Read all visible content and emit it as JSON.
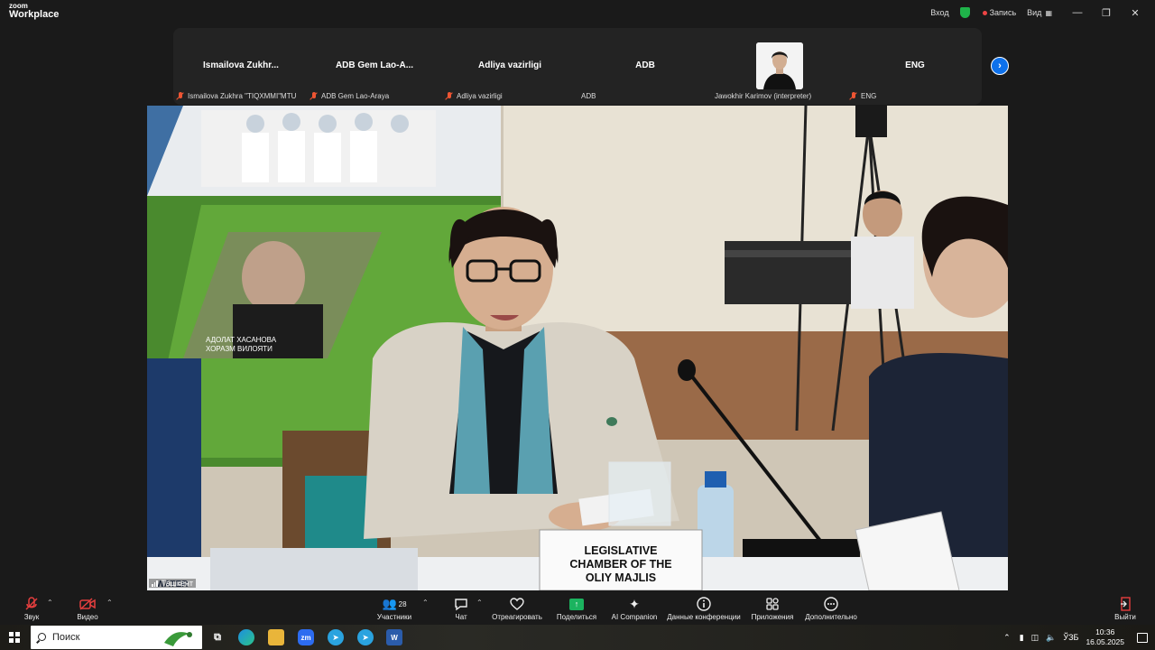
{
  "app": {
    "logo_top": "zoom",
    "logo_bottom": "Workplace"
  },
  "titlebar": {
    "signin": "Вход",
    "record": "Запись",
    "view": "Вид",
    "minimize": "—",
    "restore": "❐",
    "close": "✕"
  },
  "gallery": {
    "tiles": [
      {
        "name": "Ismailova  Zukhr...",
        "label": "Ismailova Zukhra \"TIQXMMI\"MTU",
        "muted": true
      },
      {
        "name": "ADB Gem Lao-A...",
        "label": "ADB Gem Lao-Araya",
        "muted": true
      },
      {
        "name": "Adliya vazirligi",
        "label": "Adliya vazirligi",
        "muted": true
      },
      {
        "name": "ADB",
        "label": "ADB",
        "muted": false
      },
      {
        "name": "",
        "label": "Jawokhir Karimov (interpreter)",
        "muted": false
      },
      {
        "name": "ENG",
        "label": "ENG",
        "muted": true
      }
    ],
    "next": "›"
  },
  "video": {
    "location_label": "Ташкент",
    "poster_caption_line1": "АДОЛАТ ХАСАНОВА",
    "poster_caption_line2": "ХОРАЗМ ВИЛОЯТИ",
    "nameplate": [
      "LEGISLATIVE",
      "CHAMBER OF THE",
      "OLIY MAJLIS"
    ],
    "corner_text": "WATER"
  },
  "toolbar": {
    "audio": "Звук",
    "video": "Видео",
    "participants": "Участники",
    "participants_count": "28",
    "chat": "Чат",
    "react": "Отреагировать",
    "share": "Поделиться",
    "ai": "AI Companion",
    "info": "Данные конференции",
    "apps": "Приложения",
    "more": "Дополнительно",
    "leave": "Выйти"
  },
  "taskbar": {
    "search_placeholder": "Поиск",
    "lang": "ЎЗБ",
    "time": "10:36",
    "date": "16.05.2025",
    "zm_label": "zm",
    "word_label": "W"
  },
  "colors": {
    "accent": "#0e71eb",
    "share": "#1bb35f",
    "muted": "#e53e3e",
    "security": "#1fb34a"
  }
}
